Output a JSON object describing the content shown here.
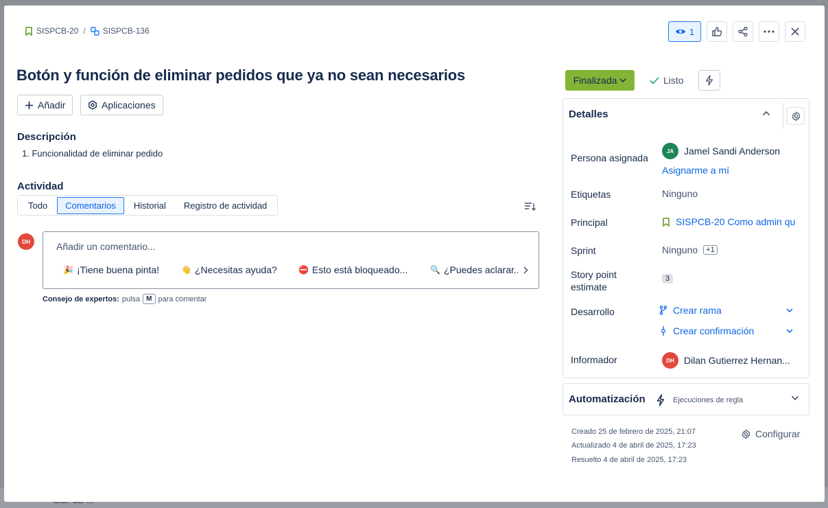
{
  "background": {
    "partial_text": "SISPCB-..."
  },
  "breadcrumb": {
    "parent": "SISPCB-20",
    "current": "SISPCB-136"
  },
  "top_actions": {
    "watch_count": "1"
  },
  "issue": {
    "title": "Botón y función de eliminar pedidos que ya no sean necesarios"
  },
  "toolbar": {
    "add_label": "Añadir",
    "apps_label": "Aplicaciones"
  },
  "description": {
    "heading": "Descripción",
    "items": [
      "Funcionalidad de eliminar pedido"
    ]
  },
  "activity": {
    "heading": "Actividad",
    "tabs": [
      "Todo",
      "Comentarios",
      "Historial",
      "Registro de actividad"
    ],
    "active_tab": "Comentarios"
  },
  "comment": {
    "avatar_initials": "DH",
    "placeholder": "Añadir un comentario...",
    "quick_replies": [
      {
        "emoji": "🎉",
        "label": "¡Tiene buena pinta!"
      },
      {
        "emoji": "👋",
        "label": "¿Necesitas ayuda?"
      },
      {
        "emoji": "⛔",
        "label": "Esto está bloqueado..."
      },
      {
        "emoji": "🔍",
        "label": "¿Puedes aclarar...?"
      }
    ],
    "tip_bold": "Consejo de expertos:",
    "tip_pre": "pulsa",
    "tip_key": "M",
    "tip_post": "para comentar"
  },
  "status": {
    "label": "Finalizada",
    "resolution": "Listo",
    "color": "#82b536"
  },
  "details": {
    "heading": "Detalles",
    "assignee_label": "Persona asignada",
    "assignee_initials": "JA",
    "assignee_name": "Jamel Sandi Anderson",
    "assign_me": "Asignarme a mí",
    "labels_label": "Etiquetas",
    "labels_value": "Ninguno",
    "parent_label": "Principal",
    "parent_value": "SISPCB-20 Como admin qu",
    "sprint_label": "Sprint",
    "sprint_value": "Ninguno",
    "sprint_extra": "+1",
    "story_label": "Story point estimate",
    "story_value": "3",
    "dev_label": "Desarrollo",
    "dev_branch": "Crear rama",
    "dev_commit": "Crear confirmación",
    "reporter_label": "Informador",
    "reporter_initials": "DH",
    "reporter_name": "Dilan Gutierrez Hernan..."
  },
  "automation": {
    "heading": "Automatización",
    "sub": "Ejecuciones de regla"
  },
  "meta": {
    "created": "Creado 25 de febrero de 2025, 21:07",
    "updated": "Actualizado 4 de abril de 2025, 17:23",
    "resolved": "Resuelto 4 de abril de 2025, 17:23",
    "configure": "Configurar"
  },
  "colors": {
    "accent": "#0c66e4",
    "parent_icon": "#6a9a23",
    "avatar_dh": "#e2483d",
    "avatar_ja": "#1f845a"
  }
}
